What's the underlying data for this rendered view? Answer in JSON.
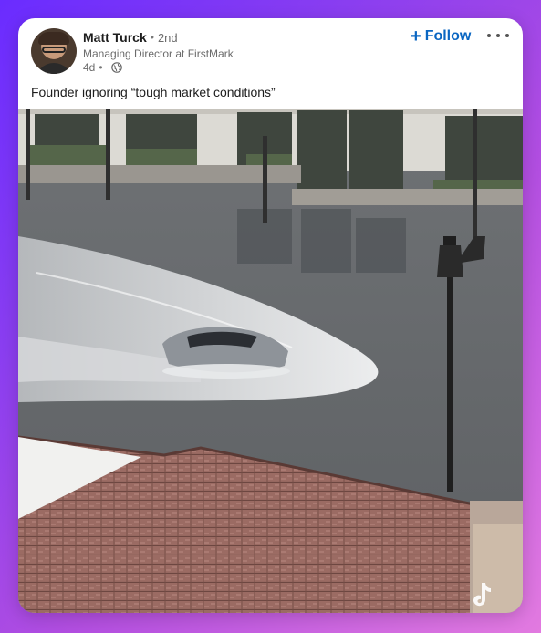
{
  "post": {
    "author": {
      "name": "Matt Turck",
      "degree": "2nd",
      "headline": "Managing Director at FirstMark",
      "time": "4d",
      "visibility_icon": "globe-icon"
    },
    "follow_label": "Follow",
    "more_icon": "more-icon",
    "caption": "Founder ignoring “tough market conditions”",
    "media_icon": "tiktok-icon"
  },
  "colors": {
    "accent": "#0a66c2",
    "background_gradient": [
      "#6a2cff",
      "#e27ae0"
    ]
  }
}
